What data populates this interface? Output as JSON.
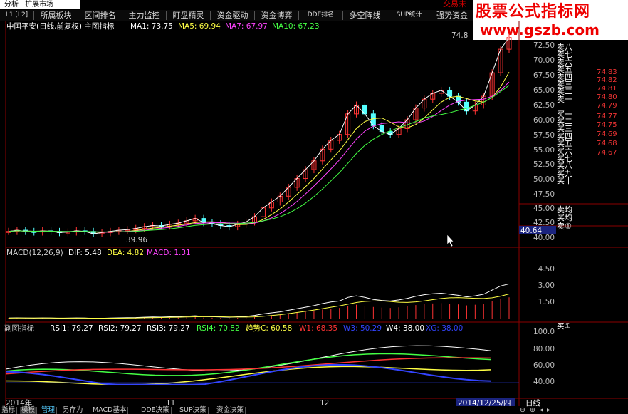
{
  "menu": {
    "item1": "分析",
    "item2": "扩展市场"
  },
  "top_right_text": "交易未",
  "tabs": [
    "L1 [L2]",
    "所属板块",
    "区间排名",
    "主力监控",
    "盯盘精灵",
    "资金驱动",
    "资金博弈",
    "DDE排名",
    "多空阵线",
    "SUP统计",
    "强势资金"
  ],
  "watermark": {
    "line1": "股票公式指标网",
    "line2": "www.gszb.com"
  },
  "main_chart": {
    "title": "中国平安(日线,前复权) 主图指标",
    "ma1": "MA1: 73.75",
    "ma5": "MA5: 69.94",
    "ma7": "MA7: 67.97",
    "ma10": "MA10: 67.23",
    "low_label": "39.96",
    "high_label": "74.8",
    "current_price_box": "40.64",
    "y_ticks": [
      "72.50",
      "70.00",
      "67.50",
      "65.00",
      "62.50",
      "60.00",
      "57.50",
      "55.00",
      "52.50",
      "50.00",
      "47.50",
      "45.00",
      "42.50",
      "40.00"
    ]
  },
  "order_book": {
    "labels": [
      "卖八",
      "卖七",
      "卖六",
      "卖五",
      "卖四",
      "卖三",
      "卖二",
      "卖一",
      "买一",
      "买二",
      "买三",
      "买四",
      "买五",
      "买六",
      "买七",
      "买八",
      "买九",
      "买十",
      "卖均",
      "买均",
      "卖①"
    ],
    "prices": [
      "74.83",
      "74.82",
      "74.81",
      "74.80",
      "74.79",
      "74.77",
      "74.75",
      "74.69",
      "74.68",
      "74.67"
    ]
  },
  "macd": {
    "title": "MACD(12,26,9)",
    "dif": "DIF: 5.48",
    "dea": "DEA: 4.82",
    "macd": "MACD: 1.31",
    "y_ticks": [
      "4.50",
      "3.00",
      "1.50"
    ]
  },
  "sub": {
    "title": "副图指标",
    "rsi1": "RSI1: 79.27",
    "rsi2": "RSI2: 79.27",
    "rsi3": "RSI3: 79.27",
    "rsi4": "RSI4: 70.82",
    "trend": "趋势C: 60.58",
    "w1": "W1: 68.35",
    "w3": "W3: 50.29",
    "w4": "W4: 38.00",
    "xg": "XG: 38.00",
    "y_ticks": [
      "100.0",
      "80.00",
      "60.00",
      "40.00"
    ],
    "buy_label": "买①"
  },
  "timeline": {
    "year": "2014年",
    "m11": "11",
    "m12": "12",
    "date_box": "2014/12/25/四",
    "period": "日线"
  },
  "bottom_tabs": [
    "指标",
    "模板",
    "管理",
    "另存为",
    "MACD基本",
    "DDE决策",
    "SUP决策",
    "资金决策"
  ],
  "colors": {
    "up": "#ff3333",
    "down": "#54ffff",
    "ma1": "#ffffff",
    "ma5": "#ffff44",
    "ma7": "#ff44ff",
    "ma10": "#44ff44",
    "grid": "#8b0000"
  }
}
